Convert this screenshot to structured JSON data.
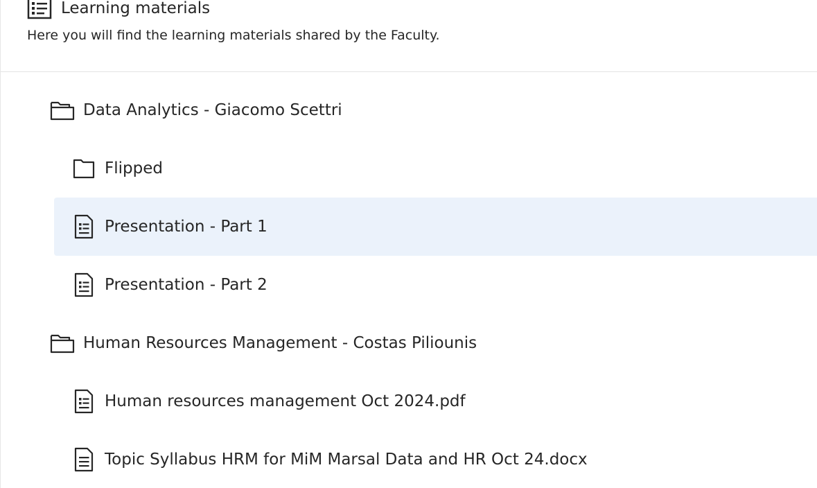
{
  "header": {
    "title": "Learning materials",
    "description": "Here you will find the learning materials shared by the Faculty."
  },
  "tree": {
    "folders": [
      {
        "label": "Data Analytics - Giacomo Scettri",
        "items": [
          {
            "label": "Flipped",
            "type": "folder",
            "icon": "folder-icon"
          },
          {
            "label": "Presentation - Part 1",
            "type": "document",
            "icon": "document-icon",
            "selected": true
          },
          {
            "label": "Presentation - Part 2",
            "type": "document",
            "icon": "document-icon"
          }
        ]
      },
      {
        "label": "Human Resources Management - Costas Piliounis",
        "items": [
          {
            "label": "Human resources management Oct 2024.pdf",
            "type": "document",
            "icon": "document-icon"
          },
          {
            "label": "Topic Syllabus HRM for MiM Marsal Data and HR Oct 24.docx",
            "type": "document",
            "icon": "document-icon"
          }
        ]
      }
    ]
  },
  "colors": {
    "text": "#262626",
    "selected_background": "#ebf2fb",
    "divider": "#e3e3e3"
  }
}
